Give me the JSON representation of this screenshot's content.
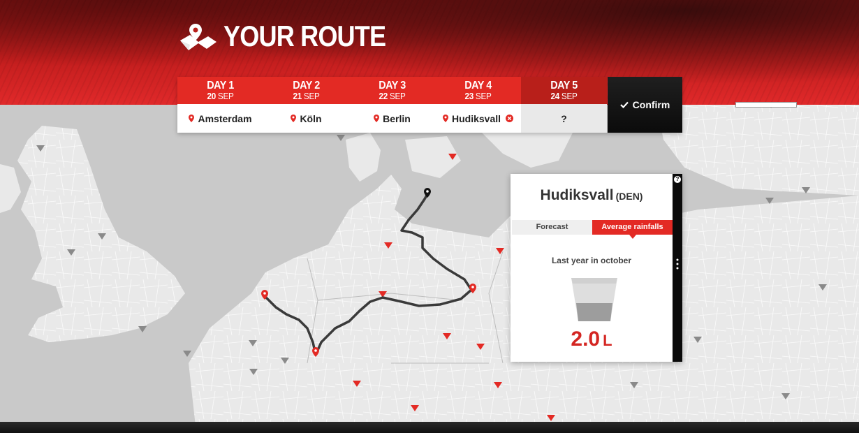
{
  "header": {
    "title": "YOUR ROUTE",
    "logo_icon": "folded-map-pin-icon"
  },
  "days": [
    {
      "label": "DAY 1",
      "date_num": "20",
      "date_month": "SEP",
      "city": "Amsterdam",
      "removable": false
    },
    {
      "label": "DAY 2",
      "date_num": "21",
      "date_month": "SEP",
      "city": "Köln",
      "removable": false
    },
    {
      "label": "DAY 3",
      "date_num": "22",
      "date_month": "SEP",
      "city": "Berlin",
      "removable": false
    },
    {
      "label": "DAY 4",
      "date_num": "23",
      "date_month": "SEP",
      "city": "Hudiksvall",
      "removable": true
    },
    {
      "label": "DAY 5",
      "date_num": "24",
      "date_month": "SEP",
      "city": "?",
      "removable": false
    }
  ],
  "confirm": {
    "label": "Confirm",
    "icon": "checkmark-icon"
  },
  "weather_card": {
    "city": "Hudiksvall",
    "country": "(DEN)",
    "tabs": [
      {
        "label": "Forecast",
        "active": false
      },
      {
        "label": "Average rainfalls",
        "active": true
      }
    ],
    "subtitle": "Last year in october",
    "value": "2.0",
    "unit": "L",
    "help_label": "?"
  },
  "scale_text": "",
  "colors": {
    "accent_red": "#e32a24",
    "dark": "#0b0b0b",
    "map_land": "#e9e9e9",
    "map_sea": "#c9c9c9"
  }
}
